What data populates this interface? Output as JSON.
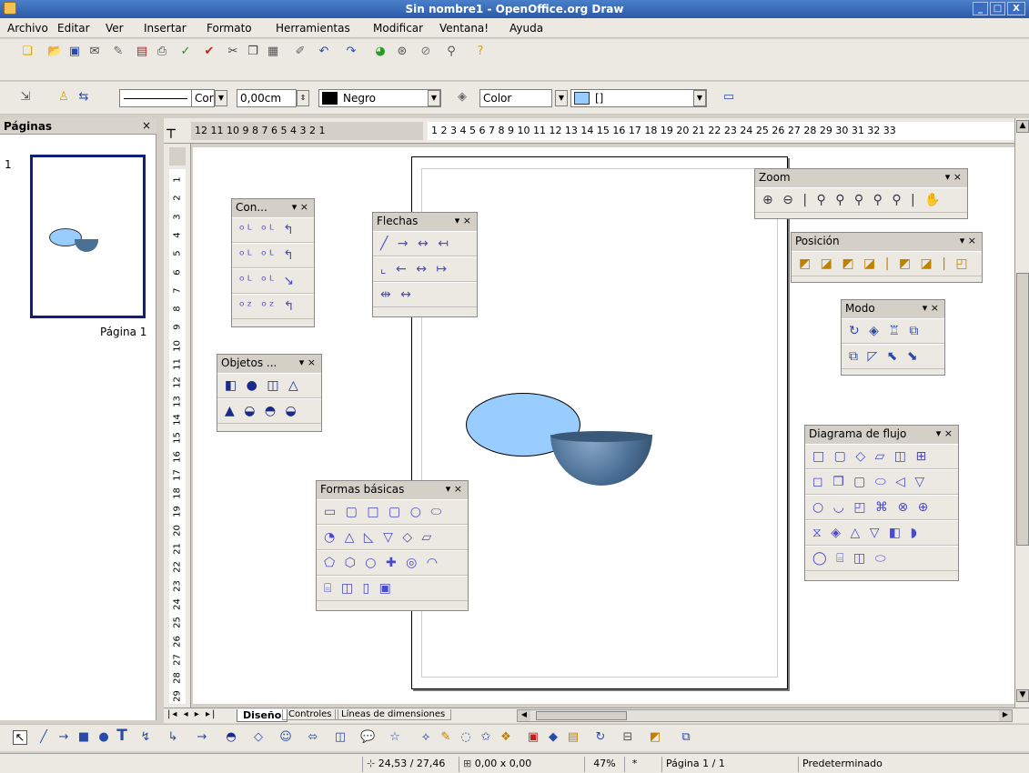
{
  "window": {
    "title": "Sin nombre1 - OpenOffice.org Draw",
    "min": "_",
    "max": "□",
    "close": "X"
  },
  "menu": [
    "Archivo",
    "Editar",
    "Ver",
    "Insertar",
    "Formato",
    "Herramientas",
    "Modificar",
    "Ventana!",
    "Ayuda"
  ],
  "line_toolbar": {
    "line_style_label": "Cor",
    "width_value": "0,00cm",
    "color_value": "Negro",
    "area_style_value": "Color",
    "area_fill_value": "[]"
  },
  "pages_panel": {
    "title": "Páginas",
    "close": "×",
    "page_number": "1",
    "page_label": "Página 1"
  },
  "ruler_h": {
    "left_nums": "12 11 10 9  8  7  6  5  4  3  2  1",
    "right_nums": "1  2  3  4  5  6  7  8  9  10 11 12 13 14 15 16 17 18 19 20 21 22 23 24 25 26 27 28 29 30 31 32 33"
  },
  "ruler_v": [
    "1",
    "2",
    "3",
    "4",
    "5",
    "6",
    "7",
    "8",
    "9",
    "10",
    "11",
    "12",
    "13",
    "14",
    "15",
    "16",
    "17",
    "18",
    "19",
    "20",
    "21",
    "22",
    "23",
    "24",
    "25",
    "26",
    "27",
    "28",
    "29"
  ],
  "floating_toolbars": {
    "connectors": {
      "title": "Con...",
      "ctl": "▾  ×"
    },
    "arrows": {
      "title": "Flechas",
      "ctl": "▾  ×"
    },
    "objects3d": {
      "title": "Objetos ...",
      "ctl": "▾  ×"
    },
    "basic_shapes": {
      "title": "Formas básicas",
      "ctl": "▾  ×"
    },
    "zoom": {
      "title": "Zoom",
      "ctl": "▾  ×"
    },
    "position": {
      "title": "Posición",
      "ctl": "▾  ×"
    },
    "mode": {
      "title": "Modo",
      "ctl": "▾  ×"
    },
    "flowchart": {
      "title": "Diagrama de flujo",
      "ctl": "▾  ×"
    }
  },
  "tabs": [
    "Diseño",
    "Controles",
    "Líneas de dimensiones"
  ],
  "status": {
    "position": "24,53 / 27,46",
    "size": "0,00 x 0,00",
    "zoom": "47%",
    "modified": "*",
    "page": "Página 1 / 1",
    "layout": "Predeterminado"
  },
  "colors": {
    "accent": "#2b5aa8",
    "ellipse_fill": "#99ccff",
    "bowl": "#4a6f94",
    "icon_blue": "#4b4bc8"
  }
}
